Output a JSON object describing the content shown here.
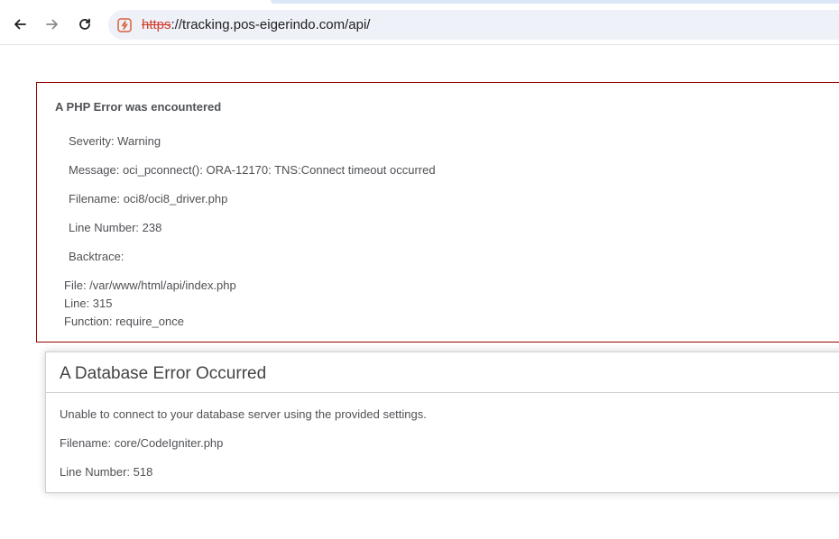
{
  "browser": {
    "url_scheme": "https",
    "url_rest": "://tracking.pos-eigerindo.com/api/",
    "icons": {
      "back": "arrow-left-icon",
      "forward": "arrow-right-icon",
      "reload": "reload-icon",
      "site_info": "not-secure-icon"
    },
    "colors": {
      "omnibox_bg": "#eef1f8",
      "scheme_warning": "#d13c2b"
    }
  },
  "php_error": {
    "title": "A PHP Error was encountered",
    "severity": "Severity: Warning",
    "message": "Message: oci_pconnect(): ORA-12170: TNS:Connect timeout occurred",
    "filename": "Filename: oci8/oci8_driver.php",
    "line_number": "Line Number: 238",
    "backtrace_label": "Backtrace:",
    "backtrace": {
      "file": "File: /var/www/html/api/index.php",
      "line": "Line: 315",
      "function": "Function: require_once"
    },
    "border_color": "#990000"
  },
  "db_error": {
    "title": "A Database Error Occurred",
    "message": "Unable to connect to your database server using the provided settings.",
    "filename": "Filename: core/CodeIgniter.php",
    "line_number": "Line Number: 518"
  }
}
